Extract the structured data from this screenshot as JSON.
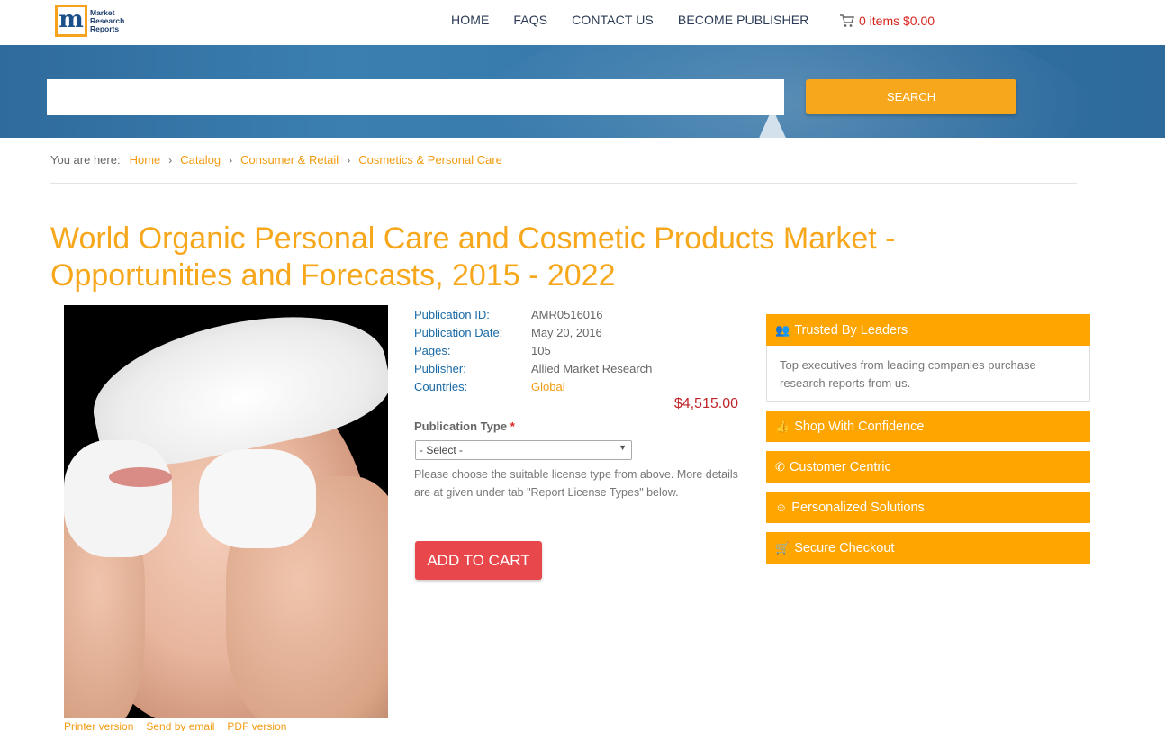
{
  "header": {
    "logo_text": [
      "Market",
      "Research",
      "Reports"
    ],
    "logo_letter": "m",
    "nav": [
      "HOME",
      "FAQS",
      "CONTACT US",
      "BECOME PUBLISHER"
    ],
    "cart": "0 items $0.00"
  },
  "search": {
    "placeholder": "",
    "button": "SEARCH"
  },
  "breadcrumb": {
    "label": "You are here:",
    "items": [
      "Home",
      "Catalog",
      "Consumer & Retail",
      "Cosmetics & Personal Care"
    ]
  },
  "product": {
    "title": "World Organic Personal Care and Cosmetic Products Market - Opportunities and Forecasts, 2015 - 2022",
    "details": [
      {
        "label": "Publication ID:",
        "value": "AMR0516016"
      },
      {
        "label": "Publication Date:",
        "value": "May 20, 2016"
      },
      {
        "label": "Pages:",
        "value": "105"
      },
      {
        "label": "Publisher:",
        "value": "Allied Market Research"
      },
      {
        "label": "Countries:",
        "value": "Global"
      }
    ],
    "price": "$4,515.00",
    "publication_type_label": "Publication Type",
    "required_mark": "*",
    "select_value": "- Select -",
    "hint": "Please choose the suitable license type from above. More details are at given under tab \"Report License Types\" below.",
    "add_to_cart": "ADD TO CART",
    "tools": [
      "Printer version",
      "Send by email",
      "PDF version"
    ]
  },
  "sidebar": {
    "items": [
      {
        "label": "Trusted By Leaders",
        "icon": "users-icon"
      },
      {
        "label": "Shop With Confidence",
        "icon": "thumbs-up-icon"
      },
      {
        "label": "Customer Centric",
        "icon": "phone-icon"
      },
      {
        "label": "Personalized Solutions",
        "icon": "smile-icon"
      },
      {
        "label": "Secure Checkout",
        "icon": "cart-icon"
      }
    ],
    "trusted_text": "Top executives from leading companies purchase research reports from us."
  },
  "colors": {
    "accent": "#f7a71b",
    "sidebar": "#ffa500",
    "add_to_cart": "#e8474c",
    "price": "#c0252a",
    "label_blue": "#1a6aa6"
  }
}
